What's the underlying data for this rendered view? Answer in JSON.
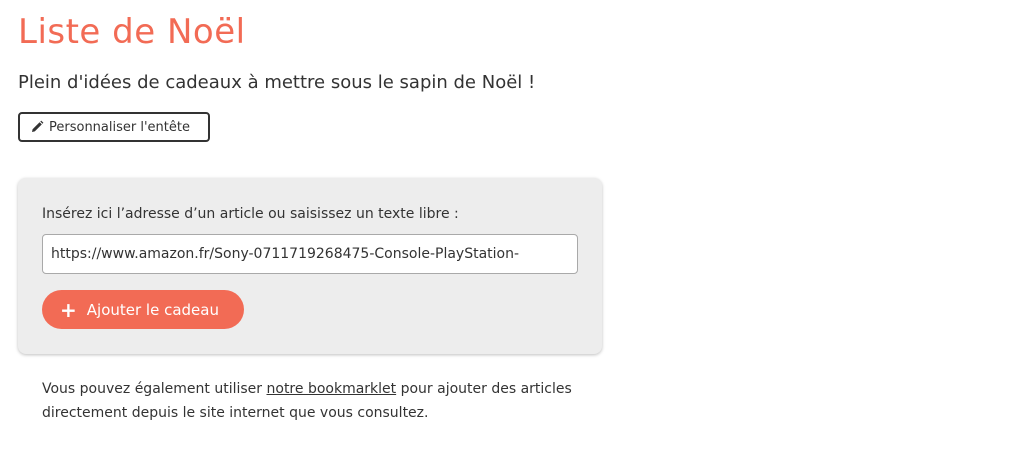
{
  "header": {
    "title": "Liste de Noël",
    "subtitle": "Plein d'idées de cadeaux à mettre sous le sapin de Noël !",
    "edit_button_label": "Personnaliser l'entête",
    "edit_button_icon": "pencil-icon"
  },
  "add_form": {
    "field_label": "Insérez ici l’adresse d’un article ou saisissez un texte libre :",
    "input_value": "https://www.amazon.fr/Sony-0711719268475-Console-PlayStation-",
    "submit_icon": "plus-icon",
    "submit_label": "Ajouter le cadeau"
  },
  "bookmarklet": {
    "text_before": "Vous pouvez également utiliser ",
    "link_text": "notre bookmarklet",
    "text_after": " pour ajouter des articles directement depuis le site internet que vous consultez."
  },
  "colors": {
    "accent": "#f26b55",
    "card_background": "#ededed",
    "text": "#333333"
  }
}
